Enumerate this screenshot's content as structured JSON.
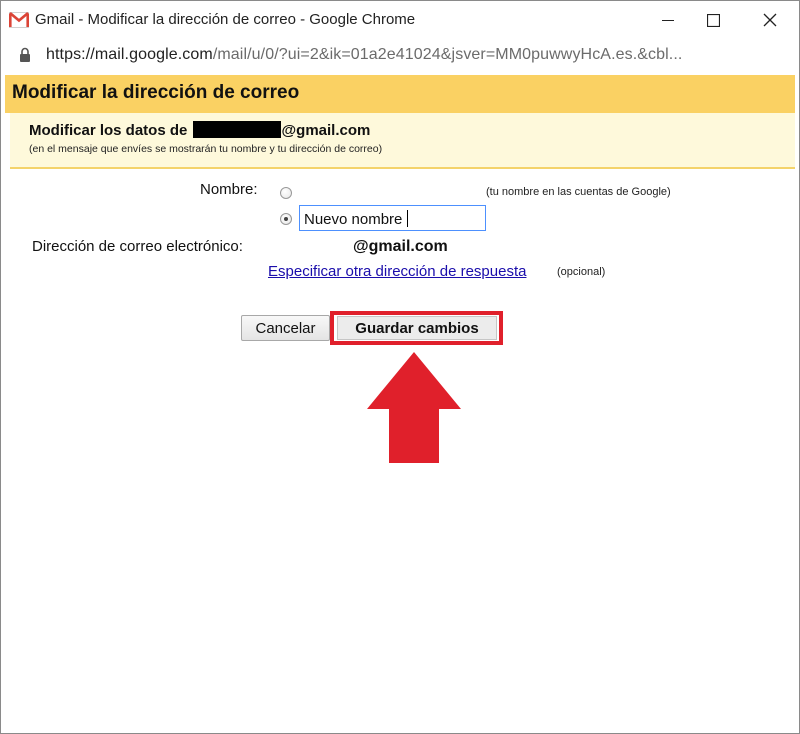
{
  "window": {
    "title": "Gmail - Modificar la dirección de correo - Google Chrome",
    "url_host": "https://mail.google.com",
    "url_path": "/mail/u/0/?ui=2&ik=01a2e41024&jsver=MM0puwwyHcA.es.&cbl..."
  },
  "dialog": {
    "title": "Modificar la dirección de correo",
    "info_prefix": "Modificar los datos de",
    "info_domain": "@gmail.com",
    "info_note": "(en el mensaje que envíes se mostrarán tu nombre y tu dirección de correo)"
  },
  "form": {
    "name_label": "Nombre:",
    "google_name_hint": "(tu nombre en las cuentas de Google)",
    "custom_name_value": "Nuevo nombre",
    "email_label": "Dirección de correo electrónico:",
    "email_domain": "@gmail.com",
    "reply_link": "Especificar otra dirección de respuesta",
    "reply_optional": "(opcional)"
  },
  "buttons": {
    "cancel": "Cancelar",
    "save": "Guardar cambios"
  },
  "colors": {
    "header": "#fad163",
    "info_panel": "#fef9db",
    "highlight": "#e0202b",
    "link": "#1a0dab"
  }
}
